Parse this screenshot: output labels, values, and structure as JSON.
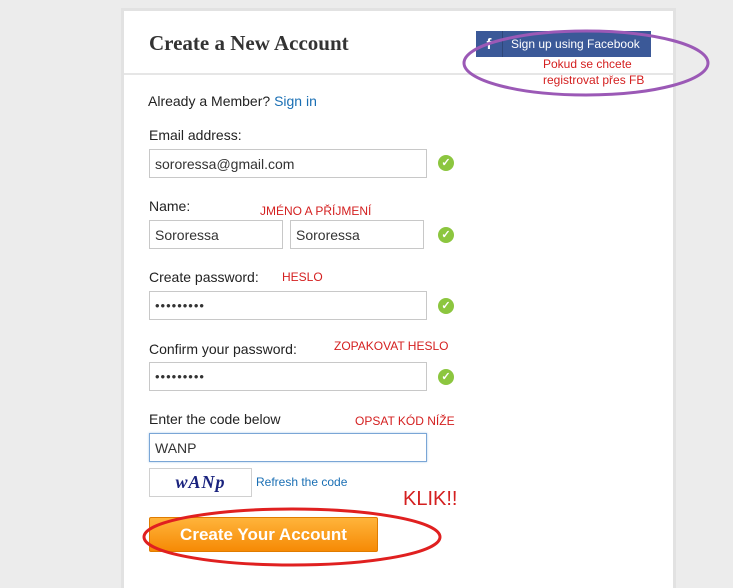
{
  "header": {
    "title": "Create a New Account",
    "facebook_icon": "f",
    "facebook_button": "Sign up using Facebook"
  },
  "member": {
    "text": "Already a Member?",
    "link": "Sign in"
  },
  "form": {
    "email_label": "Email address:",
    "email_value": "sororessa@gmail.com",
    "name_label": "Name:",
    "first_name_value": "Sororessa",
    "last_name_value": "Sororessa",
    "password_label": "Create password:",
    "password_value": "•••••••••",
    "confirm_label": "Confirm your password:",
    "confirm_value": "•••••••••",
    "code_label": "Enter the code below",
    "code_value": "WANP",
    "captcha_text": "wANp",
    "refresh_link": "Refresh the code",
    "submit_label": "Create Your Account",
    "check_icon": "✓"
  },
  "annotations": {
    "fb_note_line1": "Pokud se chcete",
    "fb_note_line2": "registrovat přes FB",
    "name_note": "JMÉNO A PŘÍJMENÍ",
    "password_note": "HESLO",
    "confirm_note": "ZOPAKOVAT HESLO",
    "code_note": "OPSAT KÓD NÍŽE",
    "submit_note": "KLIK!!"
  },
  "colors": {
    "facebook": "#3b5998",
    "link": "#1a6fb4",
    "check": "#8cc63f",
    "annotation_red": "#d42020",
    "annotation_purple": "#9b59b6",
    "submit_orange": "#f68a05"
  }
}
